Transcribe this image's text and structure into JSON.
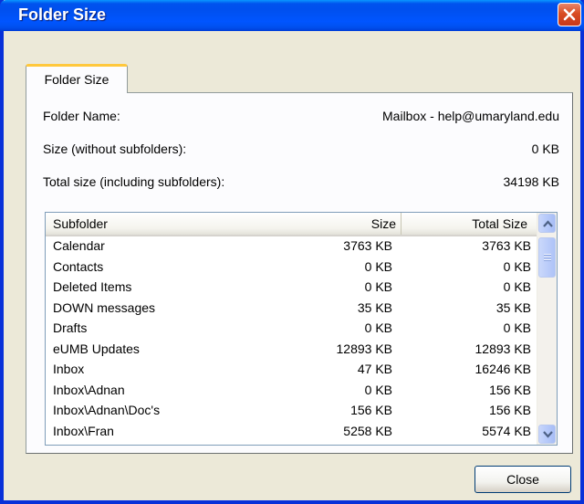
{
  "window": {
    "title": "Folder Size"
  },
  "tab": {
    "label": "Folder Size"
  },
  "info": {
    "folder_name_label": "Folder Name:",
    "folder_name_value": "Mailbox - help@umaryland.edu",
    "size_label": "Size (without subfolders):",
    "size_value": "0 KB",
    "total_label": "Total size (including subfolders):",
    "total_value": "34198 KB"
  },
  "table": {
    "headers": [
      "Subfolder",
      "Size",
      "Total Size"
    ],
    "rows": [
      [
        "Calendar",
        "3763 KB",
        "3763 KB"
      ],
      [
        "Contacts",
        "0 KB",
        "0 KB"
      ],
      [
        "Deleted Items",
        "0 KB",
        "0 KB"
      ],
      [
        "DOWN messages",
        "35 KB",
        "35 KB"
      ],
      [
        "Drafts",
        "0 KB",
        "0 KB"
      ],
      [
        "eUMB Updates",
        "12893 KB",
        "12893 KB"
      ],
      [
        "Inbox",
        "47 KB",
        "16246 KB"
      ],
      [
        "Inbox\\Adnan",
        "0 KB",
        "156 KB"
      ],
      [
        "Inbox\\Adnan\\Doc's",
        "156 KB",
        "156 KB"
      ],
      [
        "Inbox\\Fran",
        "5258 KB",
        "5574 KB"
      ]
    ]
  },
  "buttons": {
    "close_label": "Close"
  },
  "icons": {
    "title_close": "close-icon",
    "scroll_up": "chevron-up-icon",
    "scroll_down": "chevron-down-icon"
  },
  "colors": {
    "titlebar": "#0055ea",
    "tab_highlight": "#ffc83c",
    "close_button": "#d84d22"
  }
}
